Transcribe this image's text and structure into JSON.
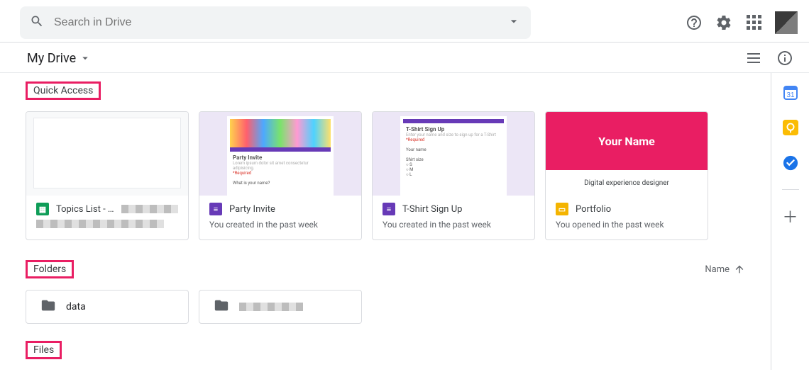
{
  "search": {
    "placeholder": "Search in Drive"
  },
  "title": "My Drive",
  "sections": {
    "quick_access": "Quick Access",
    "folders": "Folders",
    "files": "Files"
  },
  "sort": {
    "label": "Name"
  },
  "quick_access": [
    {
      "title": "Topics List - …",
      "subtitle": "",
      "icon": "sheets"
    },
    {
      "title": "Party Invite",
      "subtitle": "You created in the past week",
      "icon": "forms"
    },
    {
      "title": "T-Shirt Sign Up",
      "subtitle": "You created in the past week",
      "icon": "forms"
    },
    {
      "title": "Portfolio",
      "subtitle": "You opened in the past week",
      "icon": "slides"
    }
  ],
  "slides_thumb": {
    "headline": "Your Name",
    "sub": "Digital experience designer"
  },
  "form_thumb": {
    "title1": "Party Invite",
    "title2": "T-Shirt Sign Up"
  },
  "folders": [
    {
      "name": "data"
    },
    {
      "name": ""
    }
  ]
}
